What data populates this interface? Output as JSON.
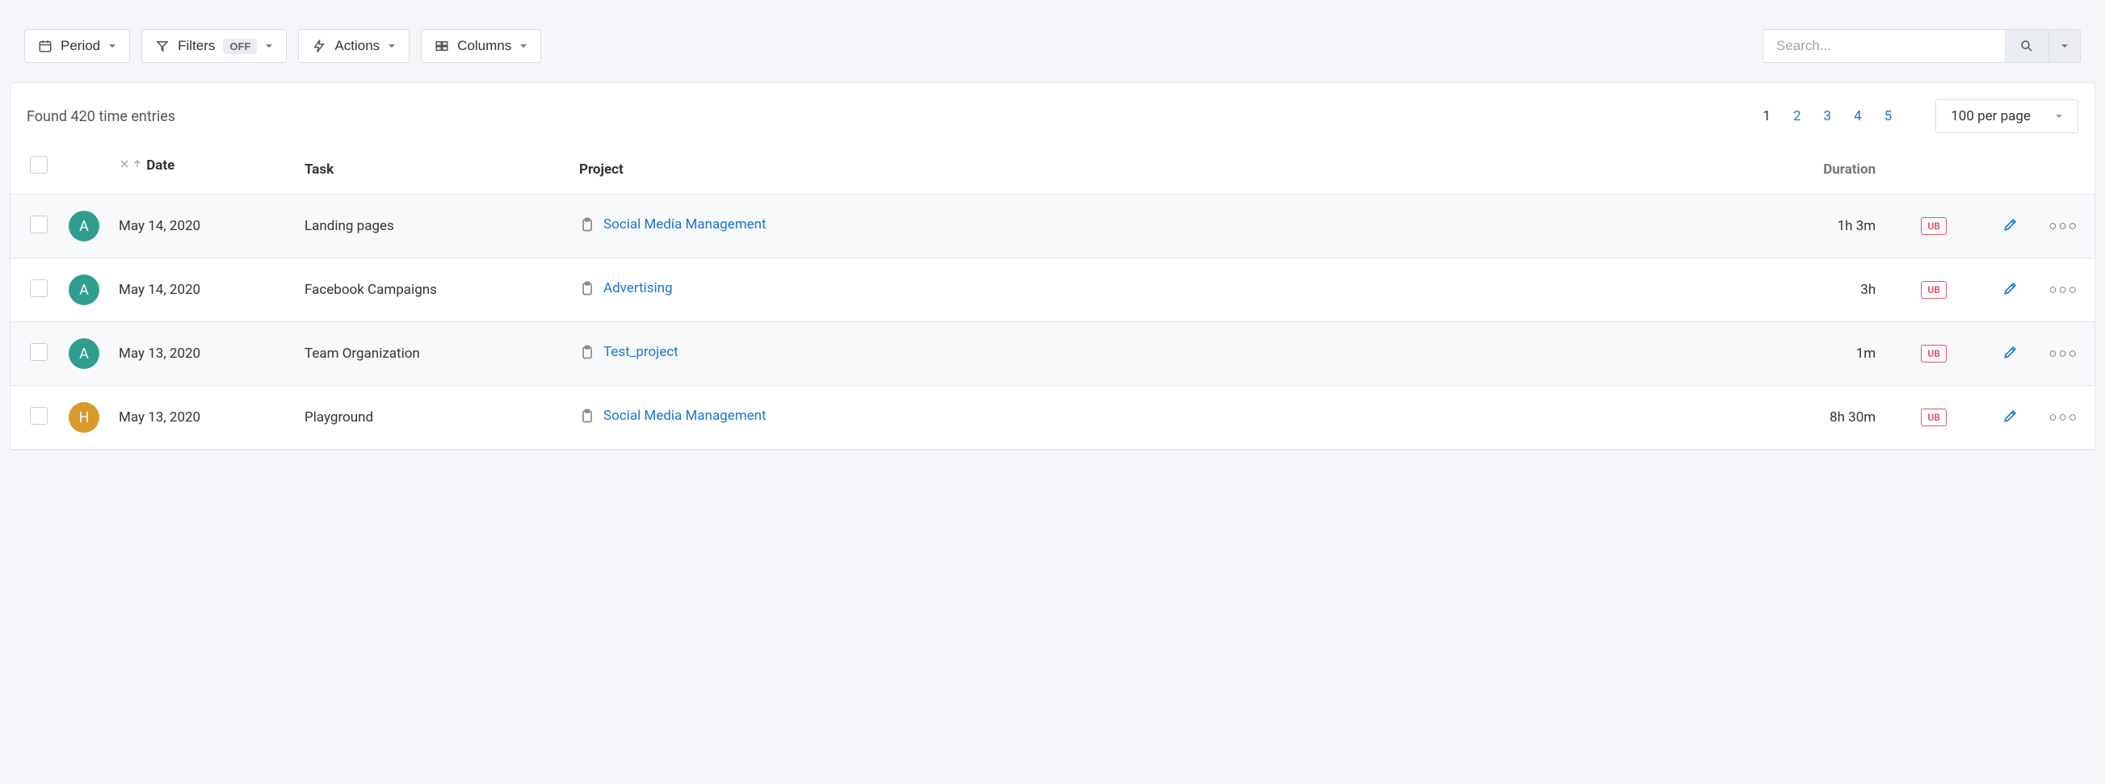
{
  "toolbar": {
    "period_label": "Period",
    "filters_label": "Filters",
    "filters_state": "OFF",
    "actions_label": "Actions",
    "columns_label": "Columns",
    "search_placeholder": "Search..."
  },
  "summary": {
    "found_text": "Found 420 time entries"
  },
  "pagination": {
    "pages": [
      "1",
      "2",
      "3",
      "4",
      "5"
    ],
    "active": "1",
    "per_page_label": "100 per page"
  },
  "table": {
    "headers": {
      "date": "Date",
      "task": "Task",
      "project": "Project",
      "duration": "Duration"
    },
    "rows": [
      {
        "avatar_letter": "A",
        "avatar_color": "#2f9e8f",
        "date": "May 14, 2020",
        "task": "Landing pages",
        "project": "Social Media Management",
        "duration": "1h 3m",
        "badge": "UB",
        "shade": true
      },
      {
        "avatar_letter": "A",
        "avatar_color": "#2f9e8f",
        "date": "May 14, 2020",
        "task": "Facebook Campaigns",
        "project": "Advertising",
        "duration": "3h",
        "badge": "UB",
        "shade": false
      },
      {
        "avatar_letter": "A",
        "avatar_color": "#2f9e8f",
        "date": "May 13, 2020",
        "task": "Team Organization",
        "project": "Test_project",
        "duration": "1m",
        "badge": "UB",
        "shade": true
      },
      {
        "avatar_letter": "H",
        "avatar_color": "#d99a2b",
        "date": "May 13, 2020",
        "task": "Playground",
        "project": "Social Media Management",
        "duration": "8h 30m",
        "badge": "UB",
        "shade": false
      }
    ]
  }
}
